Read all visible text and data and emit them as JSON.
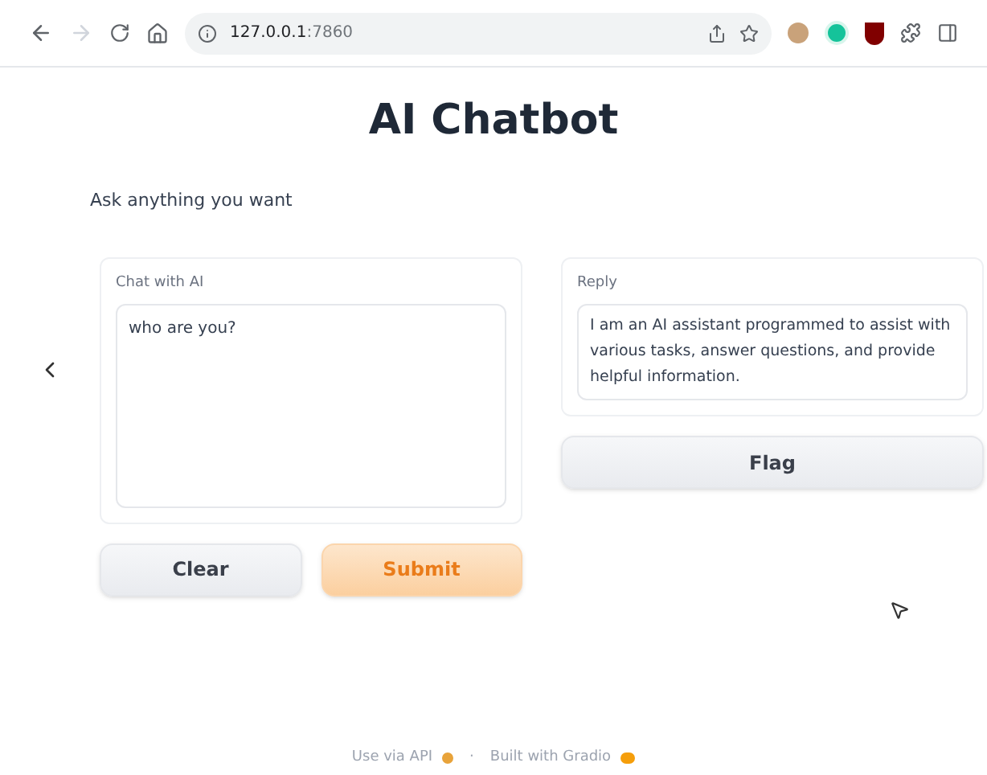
{
  "browser": {
    "address_host": "127.0.0.1",
    "address_port": ":7860"
  },
  "page": {
    "title": "AI Chatbot",
    "description": "Ask anything you want"
  },
  "input_panel": {
    "label": "Chat with AI",
    "value": "who are you?"
  },
  "output_panel": {
    "label": "Reply",
    "value": "I am an AI assistant programmed to assist with various tasks, answer questions, and provide helpful information."
  },
  "buttons": [
    {
      "label": "Clear",
      "kind": "secondary"
    },
    {
      "label": "Submit",
      "kind": "primary"
    },
    {
      "label": "Flag",
      "kind": "secondary"
    }
  ],
  "footer": {
    "api_link": "Use via API",
    "separator": "·",
    "built_with": "Built with Gradio"
  }
}
